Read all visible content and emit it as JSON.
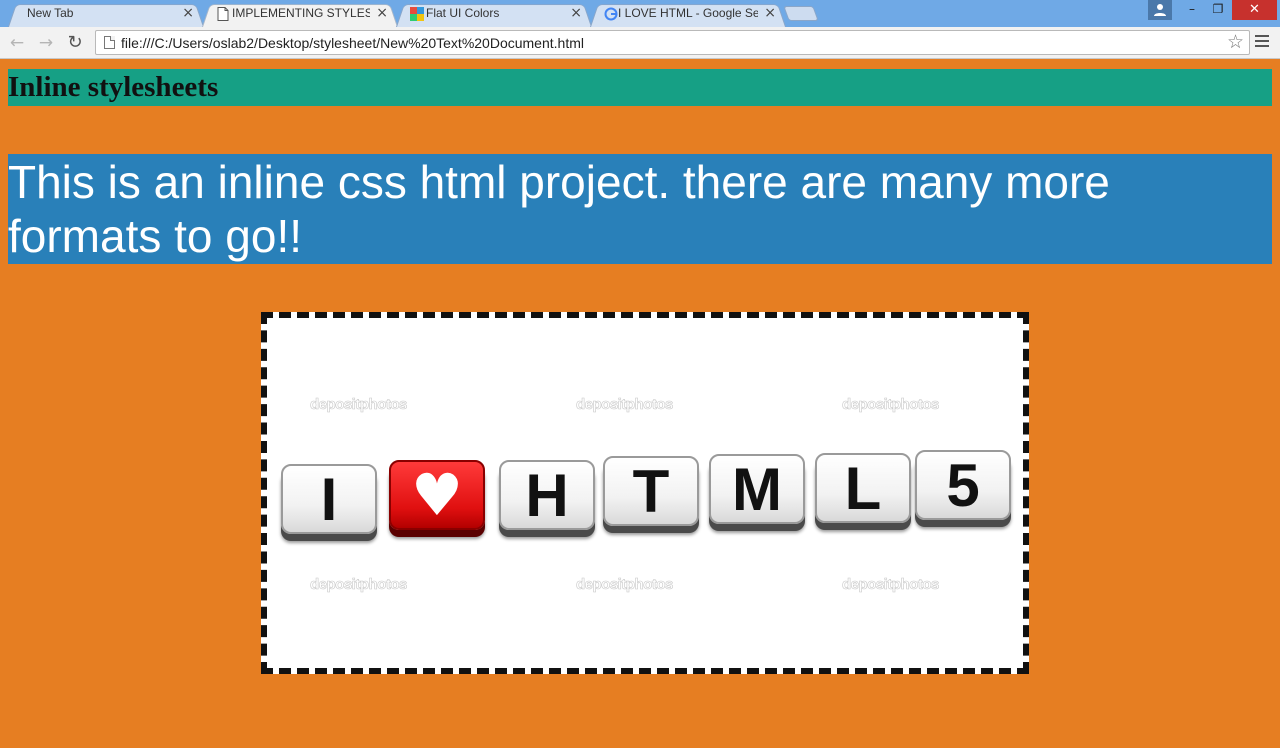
{
  "browser": {
    "tabs": [
      {
        "title": "New Tab",
        "close": "×"
      },
      {
        "title": "IMPLEMENTING STYLESHE",
        "close": "×"
      },
      {
        "title": "Flat UI Colors",
        "close": "×"
      },
      {
        "title": "I LOVE HTML - Google Se",
        "close": "×"
      }
    ],
    "window_controls": {
      "user": "▲",
      "minimize": "–",
      "maximize": "❐",
      "close": "✕"
    },
    "nav": {
      "back": "←",
      "forward": "→",
      "reload": "↻"
    },
    "url": "file:///C:/Users/oslab2/Desktop/stylesheet/New%20Text%20Document.html",
    "bookmark_icon": "☆"
  },
  "page": {
    "heading": "Inline stylesheets",
    "paragraph": "This is an inline css html project. there are many more formats to go!!",
    "image": {
      "letters": [
        "I",
        "♥",
        "H",
        "T",
        "M",
        "L",
        "5"
      ],
      "watermark": "depositphotos"
    }
  },
  "colors": {
    "page_background": "#e67e22",
    "heading_background": "#16a085",
    "paragraph_background": "#2980b9",
    "heart_cube": "#e01010"
  }
}
